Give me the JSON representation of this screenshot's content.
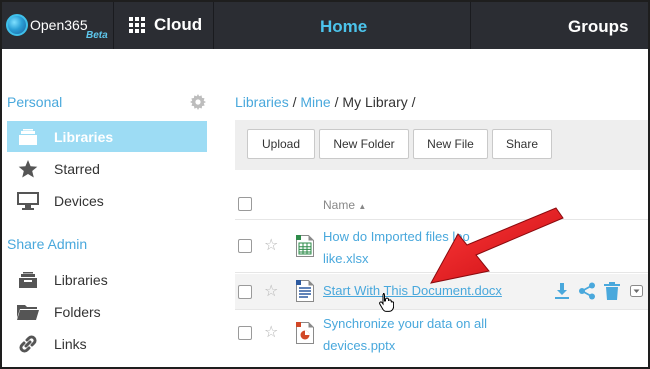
{
  "app": {
    "logo_text": "Open365",
    "logo_badge": "Beta",
    "cloud_label": "Cloud",
    "nav": {
      "home": "Home",
      "groups": "Groups"
    }
  },
  "sidebar": {
    "personal_heading": "Personal",
    "personal_items": [
      {
        "label": "Libraries",
        "icon": "library-icon"
      },
      {
        "label": "Starred",
        "icon": "star-icon"
      },
      {
        "label": "Devices",
        "icon": "monitor-icon"
      }
    ],
    "share_admin_heading": "Share Admin",
    "share_admin_items": [
      {
        "label": "Libraries",
        "icon": "library-icon"
      },
      {
        "label": "Folders",
        "icon": "folder-icon"
      },
      {
        "label": "Links",
        "icon": "link-icon"
      }
    ]
  },
  "breadcrumb": {
    "libraries": "Libraries",
    "sep1": "/",
    "mine": "Mine",
    "sep2": "/",
    "current": "My Library",
    "sep3": "/"
  },
  "toolbar": {
    "upload": "Upload",
    "new_folder": "New Folder",
    "new_file": "New File",
    "share": "Share"
  },
  "table": {
    "name_header": "Name",
    "sort_indicator": "▲",
    "files": [
      {
        "line1": "How do Imported files loo",
        "line2": "like.xlsx",
        "type": "spreadsheet"
      },
      {
        "line1": "Start With This Document.docx",
        "type": "document"
      },
      {
        "line1": "Synchronize your data on all",
        "line2": "devices.pptx",
        "type": "presentation"
      }
    ]
  },
  "colors": {
    "accent": "#49a8dc",
    "nav_bg": "#2b2d33",
    "active_item_bg": "#9ddcf4",
    "arrow": "#e8141b"
  }
}
